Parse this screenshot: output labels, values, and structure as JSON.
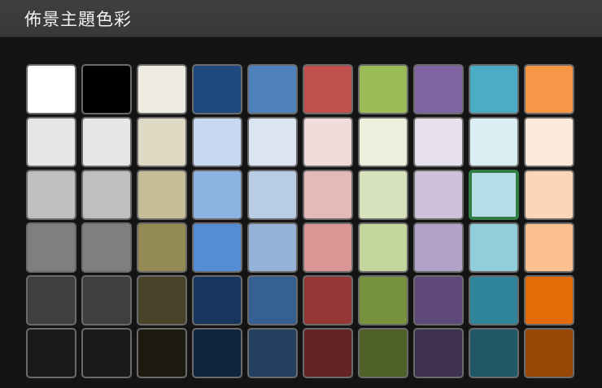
{
  "header": {
    "title": "佈景主題色彩"
  },
  "palette": {
    "selected": {
      "row": 2,
      "col": 8
    },
    "rows": [
      [
        "#ffffff",
        "#000000",
        "#eeece1",
        "#1f497d",
        "#4f81bd",
        "#c0504d",
        "#9bbb59",
        "#8064a2",
        "#4bacc6",
        "#f79646"
      ],
      [
        "#e6e6e6",
        "#e6e6e6",
        "#ddd9c3",
        "#c6d9f0",
        "#dbe5f1",
        "#f2dcdb",
        "#ebf1dd",
        "#e5e0ec",
        "#dbeef3",
        "#fdeada"
      ],
      [
        "#bfbfbf",
        "#bfbfbf",
        "#c4bd97",
        "#8db3e2",
        "#b8cce4",
        "#e5b9b7",
        "#d7e3bc",
        "#ccc1d9",
        "#b7dde8",
        "#fbd5b5"
      ],
      [
        "#7f7f7f",
        "#7f7f7f",
        "#938953",
        "#548dd4",
        "#95b3d7",
        "#d99694",
        "#c3d69b",
        "#b2a2c7",
        "#92cddc",
        "#fac08f"
      ],
      [
        "#3f3f3f",
        "#3f3f3f",
        "#494429",
        "#17365d",
        "#366092",
        "#953734",
        "#76923c",
        "#5f497a",
        "#31859b",
        "#e36c09"
      ],
      [
        "#1a1a1a",
        "#1a1a1a",
        "#1d1b10",
        "#0f243e",
        "#244061",
        "#632423",
        "#4f6128",
        "#3f3151",
        "#205867",
        "#974806"
      ]
    ]
  }
}
